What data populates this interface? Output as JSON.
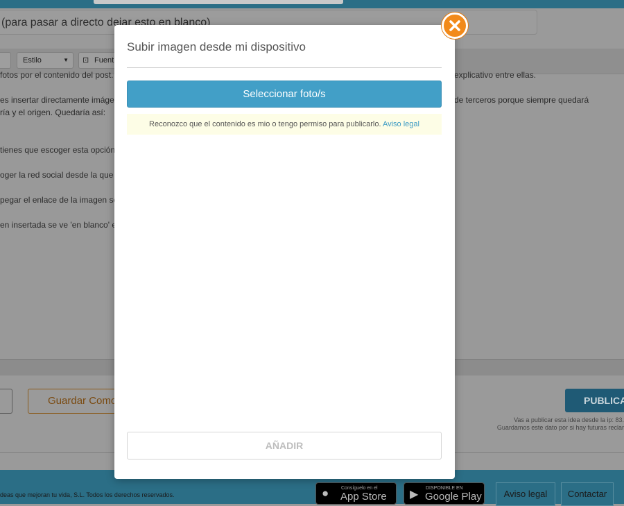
{
  "background": {
    "title_placeholder": "(para pasar a directo dejar esto en blanco)",
    "toolbar": {
      "style_label": "Estilo",
      "font_label": "Fuent"
    },
    "content_lines": [
      "fotos por el contenido del post.",
      "explicativo entre ellas.",
      "es insertar directamente imágene",
      "de terceros porque siempre quedará",
      "ría y el origen. Quedaría así:",
      "tienes que escoger esta opción",
      "oger la red social desde la que q",
      "pegar el enlace de la imagen se",
      "en insertada se ve 'en blanco' e"
    ],
    "save_draft_label": "Guardar Como",
    "publish_label": "PUBLICA",
    "ip_note_line1": "Vas a publicar esta idea desde la ip: 83.",
    "ip_note_line2": "Guardamos este dato por si hay futuras reclar",
    "footer": {
      "copyright": "deas que mejoran tu vida, S.L. Todos los derechos reservados.",
      "appstore_small": "Consíguelo en el",
      "appstore_big": "App Store",
      "googleplay_small": "DISPONIBLE EN",
      "googleplay_big": "Google Play",
      "legal_link": "Aviso legal",
      "contact_link": "Contactar"
    }
  },
  "modal": {
    "title": "Subir imagen desde mi dispositivo",
    "select_button": "Seleccionar foto/s",
    "notice_text": "Reconozco que el contenido es mio o tengo permiso para publicarlo.",
    "notice_link": "Aviso legal",
    "add_button": "AÑADIR"
  },
  "colors": {
    "accent": "#429fc7",
    "close": "#f28a1a",
    "header": "#2b6e86"
  }
}
